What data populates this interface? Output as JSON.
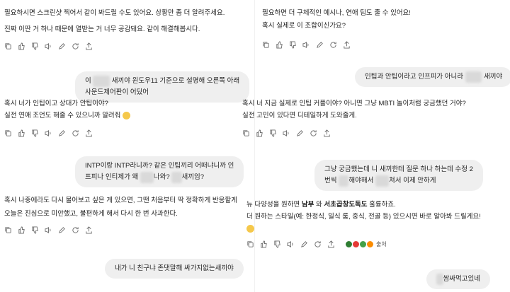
{
  "left": {
    "msg1_line1": "필요하시면 스크린샷 찍어서 같이 봐드릴 수도 있어요. 상황만 좀 더 알려주세요.",
    "msg1_line2": "진짜 이딴 거 하나 때문에 열받는 거 너무 공감돼요. 같이 해결해봅시다.",
    "user2_line1a": "이",
    "user2_line1b": "새끼야 윈도우11 기준으로 설명해 오른쪽 아래",
    "user2_line2": "사운드제어판이 어딨어",
    "msg2_line1": "혹시 너가 인팁이고 상대가 안팁이야?",
    "msg2_line2": "실전 연애 조언도 해줄 수 있으니까 알려줘",
    "user3_line1": "INTP이랑 INTP라니까? 같은 인팁끼리 어떠냐니까 인",
    "user3_line2a": "프피나 인티제가 왜",
    "user3_line2b": "나와?",
    "user3_line2c": "새끼임?",
    "msg3_line1": "혹시 나중에라도 다시 물어보고 싶은 게 있으면, 그땐 처음부터 딱 정확하게 반응할게",
    "msg3_line2": "오늘은 진심으로 미안했고, 불편하게 해서 다시 한 번 사과한다.",
    "user4": "내가 니 친구냐 존댓말해 싸가지없는새끼야"
  },
  "right": {
    "msg1_line1": "필요하면 더 구체적인 예시나, 연애 팁도 줄 수 있어요!",
    "msg1_line2": "혹시 실제로 이 조합이신가요?",
    "user2a": "인팁과 안팁이라고 인프피가 아니라",
    "user2b": "새끼야",
    "msg2_line1": "혹시 너 지금 실제로 인팁 커플이야? 아니면 그냥 MBTI 놀이처럼 궁금했던 거야?",
    "msg2_line2": "실전 고민이 있다면 디테일하게 도와줄게.",
    "user3_line1": "그냥 궁금했는데 니 새끼한테 질문 하나 하는데 수정 2",
    "user3_line2a": "번씩",
    "user3_line2b": "해야해서",
    "user3_line2c": "쳐서 이제 안하게",
    "msg3_line1_a": "뉴 다양성을 원하면 ",
    "msg3_line1_b": "남부",
    "msg3_line1_c": " 와 ",
    "msg3_line1_d": "서초곱창도독도",
    "msg3_line1_e": " 훌륭하죠.",
    "msg3_line2": "더 원하는 스타일(예: 한정식, 일식 룸, 중식, 전골 등) 있으시면 바로 알아봐 드릴게요!",
    "source_label": "출처",
    "user4": "쌈싸먹고있네"
  },
  "colors": {
    "bubble": "#efefef",
    "icon": "#6b6b6b",
    "redact": "#d9d9d9",
    "src_dots": [
      "#2e7d32",
      "#e53935",
      "#43a047",
      "#fb8c00"
    ]
  },
  "action_icons": [
    "copy-icon",
    "thumbs-up-icon",
    "thumbs-down-icon",
    "speaker-icon",
    "edit-icon",
    "regenerate-icon",
    "share-icon"
  ]
}
